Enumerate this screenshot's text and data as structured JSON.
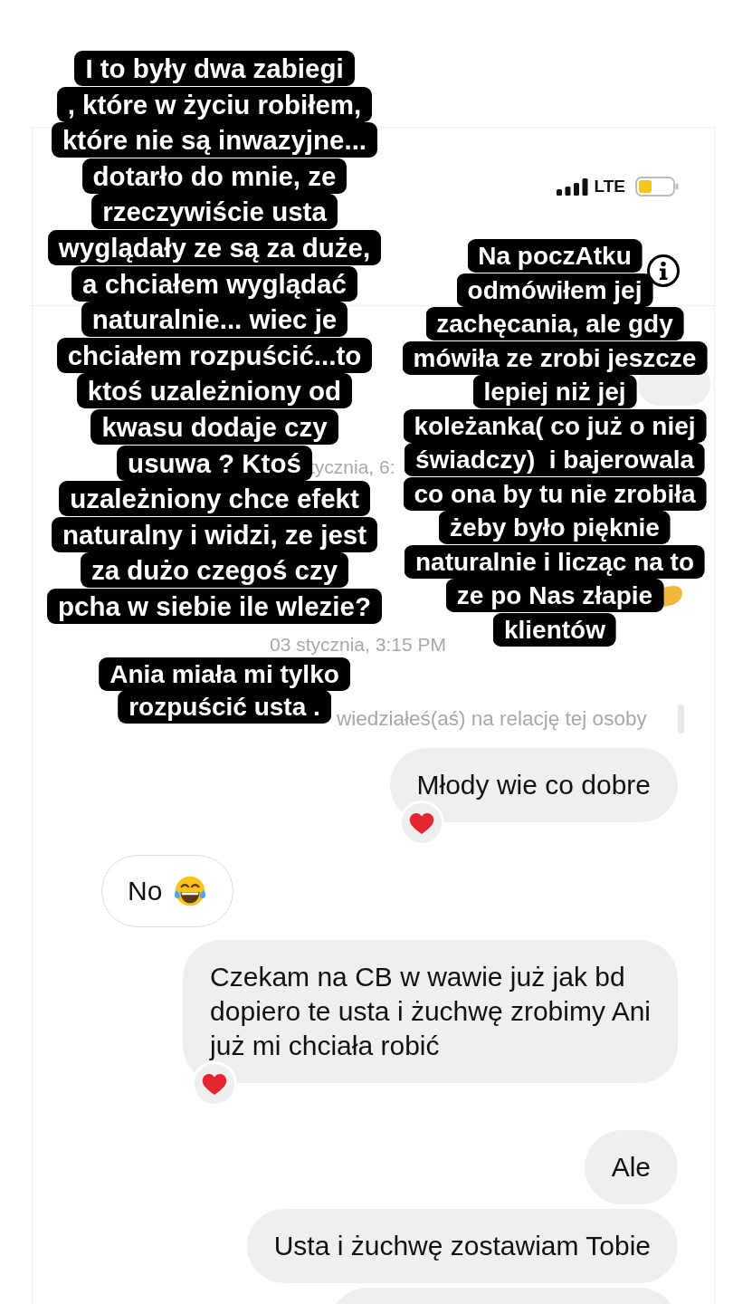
{
  "captions": [
    {
      "lines": [
        "I to były dwa zabiegi",
        ", które w życiu robiłem,",
        "które nie są inwazyjne...",
        "dotarło do mnie, ze",
        "rzeczywiście usta",
        "wyglądały ze są za duże,",
        "a chciałem wyglądać",
        "naturalnie... wiec je",
        "chciałem rozpuścić...to",
        "ktoś uzależniony od",
        "kwasu dodaje czy",
        "usuwa ? Ktoś",
        "uzależniony chce efekt",
        "naturalny i widzi, ze jest",
        "za dużo czegoś czy",
        "pcha w siebie ile wlezie?"
      ]
    },
    {
      "lines": [
        "Na poczAtku",
        "odmówiłem jej",
        "zachęcania, ale gdy",
        "mówiła ze zrobi jeszcze",
        "lepiej niż jej",
        "koleżanka( co już o niej",
        "świadczy)  i bajerowala",
        "co ona by tu nie zrobiła",
        "żeby było pięknie",
        "naturalnie i licząc na to",
        "ze po Nas złapie",
        "klientów"
      ]
    },
    {
      "lines": [
        "Ania miała mi tylko",
        "rozpuścić usta ."
      ]
    }
  ],
  "status_bar": {
    "network": "LTE"
  },
  "chat": {
    "hidden_timestamp": "tycznia, 6:",
    "date_divider": "03 stycznia, 3:15 PM",
    "story_reply_note": "wiedziałeś(aś) na relację tej osoby",
    "messages": [
      {
        "kind": "outgoing",
        "lines": [
          "Młody wie co dobre"
        ],
        "emoji": false,
        "reacted": true
      },
      {
        "kind": "incoming",
        "lines": [
          "No"
        ],
        "emoji": true,
        "reacted": false
      },
      {
        "kind": "outgoing",
        "lines": [
          "Czekam na CB w wawie już jak bd",
          "dopiero te usta i żuchwę zrobimy Ani",
          "już mi chciała robić"
        ],
        "emoji": false,
        "reacted": true
      },
      {
        "kind": "outgoing",
        "lines": [
          "Ale"
        ],
        "emoji": false,
        "reacted": false
      },
      {
        "kind": "outgoing",
        "lines": [
          "Usta i żuchwę zostawiam Tobie"
        ],
        "emoji": false,
        "reacted": false
      }
    ]
  }
}
